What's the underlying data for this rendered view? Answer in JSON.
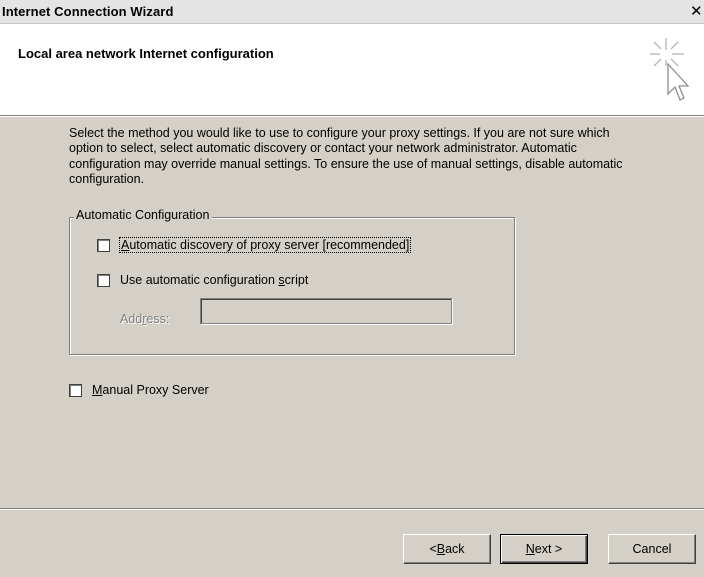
{
  "window": {
    "title": "Internet Connection Wizard",
    "close_glyph": "✕"
  },
  "header": {
    "title": "Local area network Internet configuration",
    "icon": "wizard-cursor-sparkle-icon"
  },
  "intro": {
    "text": "Select the method you would like to use to configure your proxy settings.  If you are not sure which option to select, select automatic discovery or contact your network administrator.  Automatic configuration may override manual settings.  To ensure the use of manual settings, disable automatic configuration."
  },
  "auto_config": {
    "legend": "Automatic Configuration",
    "auto_discovery": {
      "label_accel": "A",
      "label_rest": "utomatic discovery of proxy server [recommended]",
      "checked": false
    },
    "auto_script": {
      "label_pre": "Use automatic configuration ",
      "label_accel": "s",
      "label_rest": "cript",
      "checked": false
    },
    "address": {
      "label_pre": "Add",
      "label_accel": "r",
      "label_rest": "ess:",
      "value": "",
      "enabled": false
    }
  },
  "manual_proxy": {
    "label_accel": "M",
    "label_rest": "anual Proxy Server",
    "checked": false
  },
  "buttons": {
    "back_pre": "< ",
    "back_accel": "B",
    "back_rest": "ack",
    "next_accel": "N",
    "next_rest": "ext >",
    "cancel": "Cancel"
  }
}
